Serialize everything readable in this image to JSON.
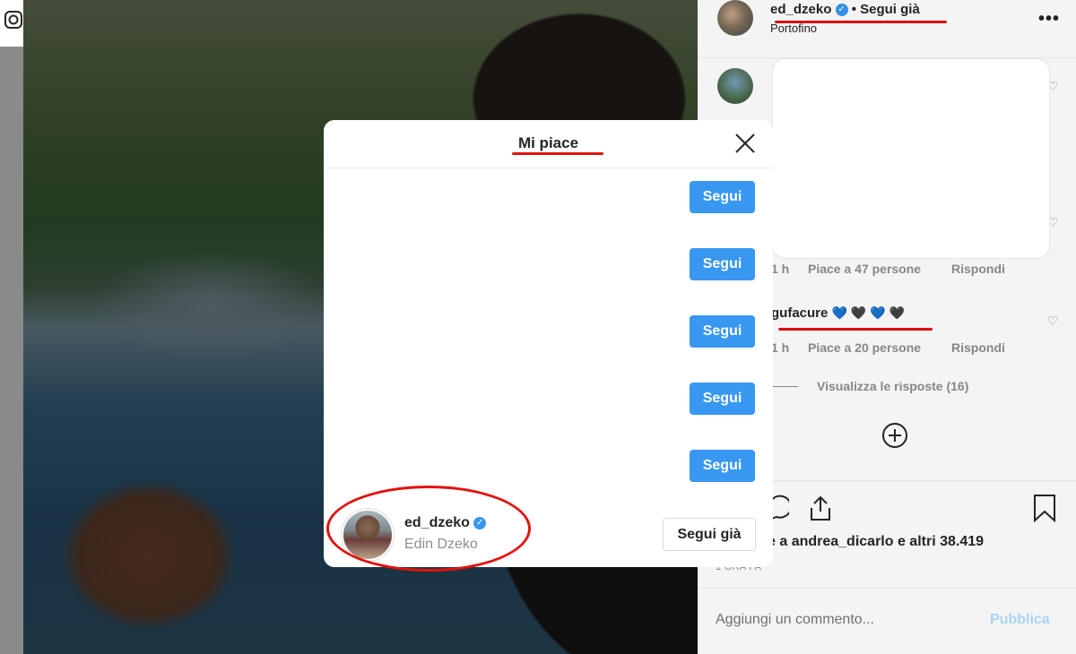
{
  "post_header": {
    "username": "ed_dzeko",
    "follow_status": "• Segui già",
    "location": "Portofino",
    "more_icon": "more-horizontal-icon"
  },
  "comments": [
    {
      "time": "1 h",
      "likes": "Piace a 47 persone",
      "reply": "Rispondi"
    },
    {
      "username": "gufacure",
      "text": "💙 🖤 💙 🖤",
      "time": "1 h",
      "likes": "Piace a 20 persone",
      "reply": "Rispondi"
    }
  ],
  "view_replies": "Visualizza le risposte (16)",
  "likes_summary": "e a andrea_dicarlo e altri 38.419",
  "timestamp": "1 ORA FA",
  "comment_input": {
    "placeholder": "Aggiungi un commento...",
    "publish_label": "Pubblica"
  },
  "modal": {
    "title": "Mi piace",
    "follow_label": "Segui",
    "last_user": {
      "username": "ed_dzeko",
      "full_name": "Edin Dzeko",
      "button": "Segui già"
    }
  },
  "colors": {
    "accent": "#3897f0",
    "annotation_red": "#e3130c",
    "text": "#262626",
    "muted": "#8e8e8e"
  }
}
